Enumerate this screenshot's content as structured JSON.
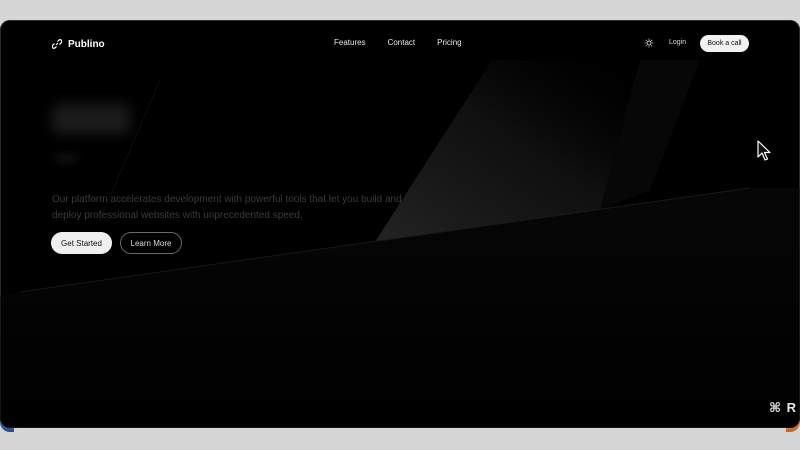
{
  "brand": {
    "name": "Publino",
    "icon": "link-icon"
  },
  "nav": {
    "links": [
      "Features",
      "Contact",
      "Pricing"
    ],
    "theme_icon": "sun-icon",
    "login": "Login",
    "cta": "Book a call"
  },
  "hero": {
    "description": "Our platform accelerates development with powerful tools that let you build and deploy professional websites with unprecedented speed.",
    "primary_button": "Get Started",
    "secondary_button": "Learn More"
  },
  "overlay": {
    "shortcut": "⌘ R",
    "cursor_icon": "mouse-pointer-icon"
  },
  "colors": {
    "background": "#000000",
    "text_primary": "#ffffff",
    "text_muted": "#3a3a3a",
    "button_light": "#efefef"
  }
}
